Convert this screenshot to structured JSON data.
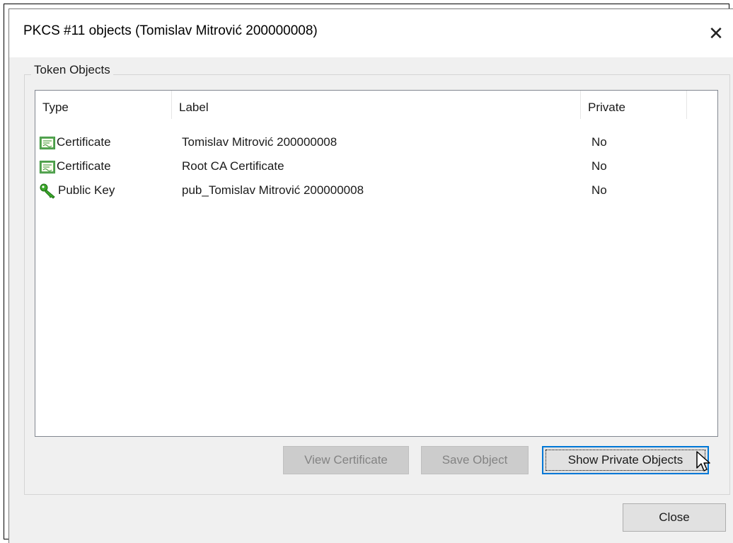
{
  "window": {
    "title": "PKCS #11 objects (Tomislav Mitrović 200000008)",
    "close_glyph": "✕"
  },
  "group": {
    "label": "Token Objects"
  },
  "list": {
    "columns": [
      "Type",
      "Label",
      "Private"
    ],
    "rows": [
      {
        "type": "Certificate",
        "icon": "certificate-icon",
        "label": "Tomislav Mitrović 200000008",
        "private": "No"
      },
      {
        "type": "Certificate",
        "icon": "certificate-icon",
        "label": "Root CA Certificate",
        "private": "No"
      },
      {
        "type": "Public Key",
        "icon": "key-icon",
        "label": "pub_Tomislav Mitrović 200000008",
        "private": "No"
      }
    ]
  },
  "buttons": {
    "view_certificate": "View Certificate",
    "save_object": "Save Object",
    "show_private": "Show Private Objects",
    "close": "Close"
  },
  "colors": {
    "dialog_bg": "#f0f0f0",
    "accent": "#0078d7",
    "key_green": "#3aa829",
    "cert_green": "#2f8f2f"
  }
}
